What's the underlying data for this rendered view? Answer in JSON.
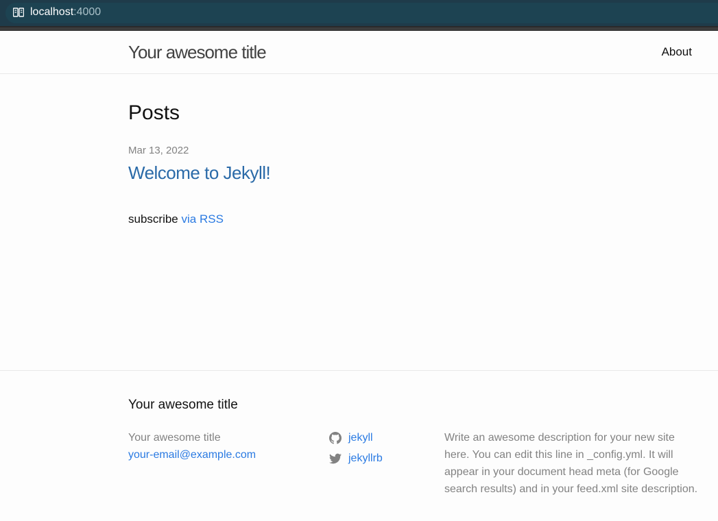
{
  "browser": {
    "url_host": "localhost",
    "url_port": ":4000",
    "icon": "reader-view-icon"
  },
  "header": {
    "site_title": "Your awesome title",
    "nav": {
      "about_label": "About"
    }
  },
  "main": {
    "heading": "Posts",
    "posts": [
      {
        "date": "Mar 13, 2022",
        "title": "Welcome to Jekyll!"
      }
    ],
    "rss": {
      "prefix": "subscribe",
      "link_label": "via RSS"
    }
  },
  "footer": {
    "heading": "Your awesome title",
    "name": "Your awesome title",
    "email": "your-email@example.com",
    "social": [
      {
        "icon": "github-icon",
        "label": "jekyll"
      },
      {
        "icon": "twitter-icon",
        "label": "jekyllrb"
      }
    ],
    "description": "Write an awesome description for your new site here. You can edit this line in _config.yml. It will appear in your document head meta (for Google search results) and in your feed.xml site description."
  },
  "colors": {
    "link": "#2a7ae2",
    "post_link": "#2a6aa8",
    "meta_text": "#828282",
    "address_bar": "#1f3b4a"
  }
}
